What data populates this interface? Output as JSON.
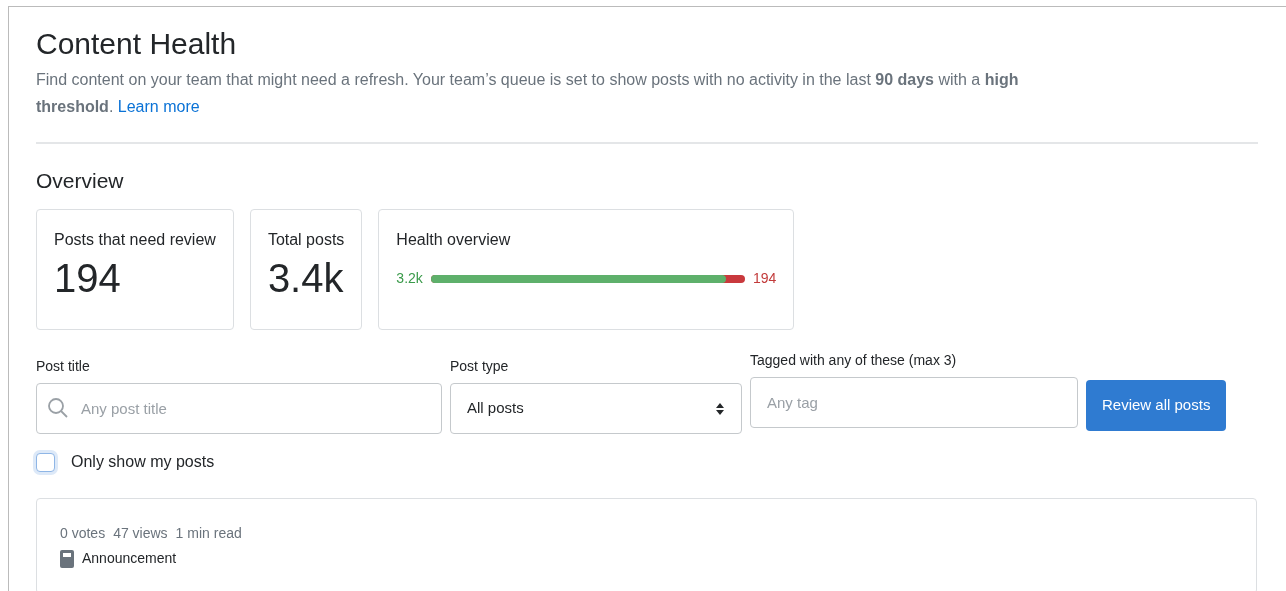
{
  "header": {
    "title": "Content Health",
    "description": "Find content on your team that might need a refresh. Your team’s queue is set to show posts with no activity in the last **90 days** with a **high threshold**.",
    "link": "Learn more"
  },
  "overview": {
    "title": "Overview",
    "stats": [
      {
        "label": "Posts that need review",
        "value": "194"
      },
      {
        "label": "Total posts",
        "value": "3.4k"
      }
    ],
    "health": {
      "label": "Health overview",
      "healthy": "3.2k",
      "needs_review": "194",
      "level": 0.94
    }
  },
  "filters": {
    "post_title": {
      "label": "Post title",
      "placeholder": "Any post title"
    },
    "post_type": {
      "label": "Post type",
      "value": "All posts"
    },
    "tags": {
      "label": "Tagged with any of these (max 3)",
      "placeholder": "Any tag"
    },
    "button": "Review all posts",
    "only_mine": {
      "label": "Only show my posts",
      "checked": false
    }
  },
  "posts": [
    {
      "meta": [
        "0 votes",
        "47 views",
        "1 min read"
      ],
      "type": "Announcement"
    }
  ]
}
